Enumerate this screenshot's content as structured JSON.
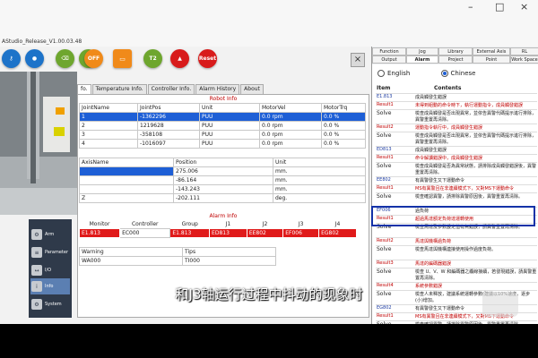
{
  "window": {
    "title": "AStudio_Release_V1.00.03.48",
    "controls": [
      "–",
      "□",
      "×"
    ]
  },
  "toolbar": {
    "buttons": [
      {
        "name": "key-button",
        "color": "#1d73c9",
        "label": ""
      },
      {
        "name": "user-button",
        "color": "#1d73c9",
        "label": ""
      },
      {
        "name": "clear-button",
        "color": "#6ea62e",
        "label": ""
      },
      {
        "name": "tool-button",
        "color": "#6ea62e",
        "label": ""
      },
      {
        "name": "off-button",
        "color": "#f08a1a",
        "label": "OFF"
      },
      {
        "name": "io-button",
        "color": "#f08a1a",
        "label": ""
      },
      {
        "name": "t2-button",
        "color": "#6ea62e",
        "label": "T2"
      },
      {
        "name": "alarm-button",
        "color": "#d81b1b",
        "label": ""
      },
      {
        "name": "reset-button",
        "color": "#d81b1b",
        "label": "Reset"
      }
    ],
    "close": "×"
  },
  "sidenav": {
    "items": [
      {
        "label": "Arm",
        "icon": "arm-icon"
      },
      {
        "label": "Parameter",
        "icon": "parameter-icon"
      },
      {
        "label": "I/O",
        "icon": "io-icon"
      },
      {
        "label": "Info",
        "icon": "info-icon"
      },
      {
        "label": "System",
        "icon": "system-icon"
      }
    ]
  },
  "tabs": [
    "fo.",
    "Temperature Info.",
    "Controller Info.",
    "Alarm History",
    "About"
  ],
  "robot_info": {
    "title": "Robot Info",
    "joint_headers": [
      "JointName",
      "JointPos",
      "Unit",
      "MotorVel",
      "MotorTrq"
    ],
    "joints": [
      [
        "1",
        "-1362296",
        "PUU",
        "0.0 rpm",
        "0.0 %"
      ],
      [
        "2",
        "1219628",
        "PUU",
        "0.0 rpm",
        "0.0 %"
      ],
      [
        "3",
        "-358108",
        "PUU",
        "0.0 rpm",
        "0.0 %"
      ],
      [
        "4",
        "-1016097",
        "PUU",
        "0.0 rpm",
        "0.0 %"
      ]
    ],
    "axis_headers": [
      "AxisName",
      "Position",
      "Unit"
    ],
    "axes": [
      [
        "",
        "275.006",
        "mm."
      ],
      [
        "",
        "-86.164",
        "mm."
      ],
      [
        "",
        "-143.243",
        "mm."
      ],
      [
        "Z",
        "-202.111",
        "deg."
      ]
    ]
  },
  "alarm_info": {
    "title": "Alarm Info",
    "headers": [
      "Monitor",
      "Controller",
      "Group",
      "J1",
      "J2",
      "J3",
      "J4"
    ],
    "row": [
      "E1.813",
      "EC000",
      "E1.813",
      "ED813",
      "EE802",
      "EF006",
      "EG802"
    ],
    "warning_headers": [
      "Warning",
      "Tips"
    ],
    "warning_row": [
      "WA000",
      "TI000"
    ]
  },
  "right_panel": {
    "tabs_row1": [
      "Function",
      "Jog",
      "Library",
      "External Axis",
      "RL"
    ],
    "tabs_row2": [
      "Output",
      "Alarm",
      "Project",
      "Point",
      "Work Space"
    ],
    "lang_en": "English",
    "lang_zh": "Chinese",
    "list_headers": [
      "Item",
      "Contents"
    ],
    "rows": [
      {
        "type": "code",
        "k": "E1.813",
        "v": "成員觸發生錯誤"
      },
      {
        "type": "result",
        "k": "Result1",
        "v": "未得到組動的命令時下，執行運動指令，成員觸發錯誤"
      },
      {
        "type": "solve",
        "k": "Solve",
        "v": "檢查成員觸發是否出現異常，並依告異警代碼提示進行排除，異警重置再清除。"
      },
      {
        "type": "result",
        "k": "Result2",
        "v": "運動指令執行中，成員觸發生錯誤"
      },
      {
        "type": "solve",
        "k": "Solve",
        "v": "檢查成員觸發是否出現異常，並依告異警代碼提示進行排除，異警重置再清除。"
      },
      {
        "type": "code",
        "k": "ED813",
        "v": "成員觸發生錯誤"
      },
      {
        "type": "result",
        "k": "Result1",
        "v": "命令解讀錯誤中，成員觸發生錯誤"
      },
      {
        "type": "solve",
        "k": "Solve",
        "v": "檢查成員觸發是否為異常狀態，請排除成員觸發錯誤後，異警重置再清除。"
      },
      {
        "type": "code",
        "k": "EE802",
        "v": "有異警發生又下運動命令"
      },
      {
        "type": "result",
        "k": "Result1",
        "v": "MS有異警且在非連續模式下，又對MS下運動命令"
      },
      {
        "type": "solve",
        "k": "Solve",
        "v": "檢查確認異警，請排除異警原因後，異警重置再清除。"
      },
      {
        "type": "code",
        "k": "EF006",
        "v": "過負荷"
      },
      {
        "type": "result",
        "k": "Result1",
        "v": "超過馬達額定負荷達運轉使用"
      },
      {
        "type": "solve",
        "k": "Solve",
        "v": "檢查馬達及參數設定值有無錯誤，請異警重置再清除。"
      },
      {
        "type": "result",
        "k": "Result2",
        "v": "馬達與機構過負荷"
      },
      {
        "type": "solve",
        "k": "Solve",
        "v": "檢查馬達與機構連接使用操作過度負荷。"
      },
      {
        "type": "result",
        "k": "Result3",
        "v": "馬達的編碼器錯誤"
      },
      {
        "type": "solve",
        "k": "Solve",
        "v": "檢查 U、V、W 和編碼器之纜線接續，若發現錯誤，請異警重置再清除。"
      },
      {
        "type": "result",
        "k": "Result4",
        "v": "系統參數錯誤"
      },
      {
        "type": "solve",
        "k": "Solve",
        "v": "檢查人未釋放，建議系統運轉參數(建議以10%速度，逐步(小)增加。"
      },
      {
        "type": "code",
        "k": "EG802",
        "v": "有異警發生又下運動命令"
      },
      {
        "type": "result",
        "k": "Result1",
        "v": "MS有異警且在非連續模式下，又對MS下運動命令"
      },
      {
        "type": "solve",
        "k": "Solve",
        "v": "檢查確認異警，請排除異警原因後，異警重置再清除。"
      }
    ]
  },
  "subtitle": "和J3轴运行过程中抖动的现象时"
}
